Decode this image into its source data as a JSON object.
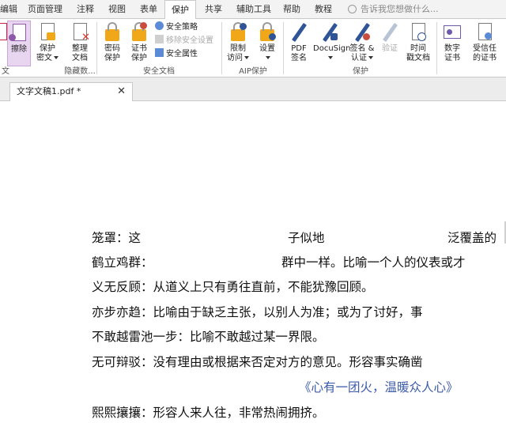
{
  "menu": {
    "tabs": [
      "编辑",
      "页面管理",
      "注释",
      "视图",
      "表单",
      "保护",
      "共享",
      "辅助工具",
      "帮助",
      "教程"
    ],
    "active_tab": "保护",
    "tell_me": "告诉我您想做什么..."
  },
  "ribbon": {
    "redact": {
      "erase": "擦除",
      "protect": "保护",
      "protect2": "密文",
      "organize": "整理",
      "organize2": "文档"
    },
    "redact_group_partial": "文",
    "hidden_group": "隐藏数...",
    "secure": {
      "password": "密码",
      "password2": "保护",
      "cert": "证书",
      "cert2": "保护",
      "policy": "安全策略",
      "remove": "移除安全设置",
      "props": "安全属性",
      "group": "安全文档"
    },
    "aip": {
      "restrict": "限制",
      "restrict2": "访问",
      "settings": "设置",
      "group": "AIP保护"
    },
    "protect": {
      "pdf_sign": "PDF",
      "pdf_sign2": "签名",
      "docusign": "DocuSign",
      "sign_cert": "签名 &",
      "sign_cert2": "认证",
      "verify": "验证",
      "timestamp": "时间",
      "timestamp2": "戳文档",
      "digital_id": "数字",
      "digital_id2": "证书",
      "trusted": "受信任",
      "trusted2": "的证书",
      "group": "保护"
    }
  },
  "document": {
    "tab_title": "文字文稿1.pdf *",
    "lines": [
      {
        "parts": [
          {
            "text": "笼罩：这"
          },
          {
            "text": "子似地"
          },
          {
            "text": "泛覆盖的"
          }
        ]
      },
      {
        "parts": [
          {
            "text": "鹤立鸡群："
          },
          {
            "text": "群中一样。比喻一个人的仪表或才"
          }
        ]
      },
      {
        "parts": [
          {
            "text": "义无反顾：从道义上只有勇往直前，不能犹豫回顾。"
          }
        ]
      },
      {
        "parts": [
          {
            "text": "亦步亦趋：比喻由于缺乏主张，以别人为准；或为了讨好，事"
          }
        ]
      },
      {
        "parts": [
          {
            "text": "不敢越雷池一步：比喻不敢越过某一界限。"
          }
        ]
      },
      {
        "parts": [
          {
            "text": "无可辩驳：没有理由或根据来否定对方的意见。形容事实确凿"
          }
        ]
      },
      {
        "parts": [
          {
            "text": "《心有一团火，温暖众人心》"
          }
        ]
      },
      {
        "parts": [
          {
            "text": "熙熙攘攘：形容人来人往，非常热闹拥挤。"
          }
        ]
      }
    ]
  },
  "colors": {
    "accent_active": "#e8d6f0",
    "link_blue": "#3b5ba9",
    "lock_gold": "#f0a819",
    "pen_blue": "#2f5597"
  }
}
